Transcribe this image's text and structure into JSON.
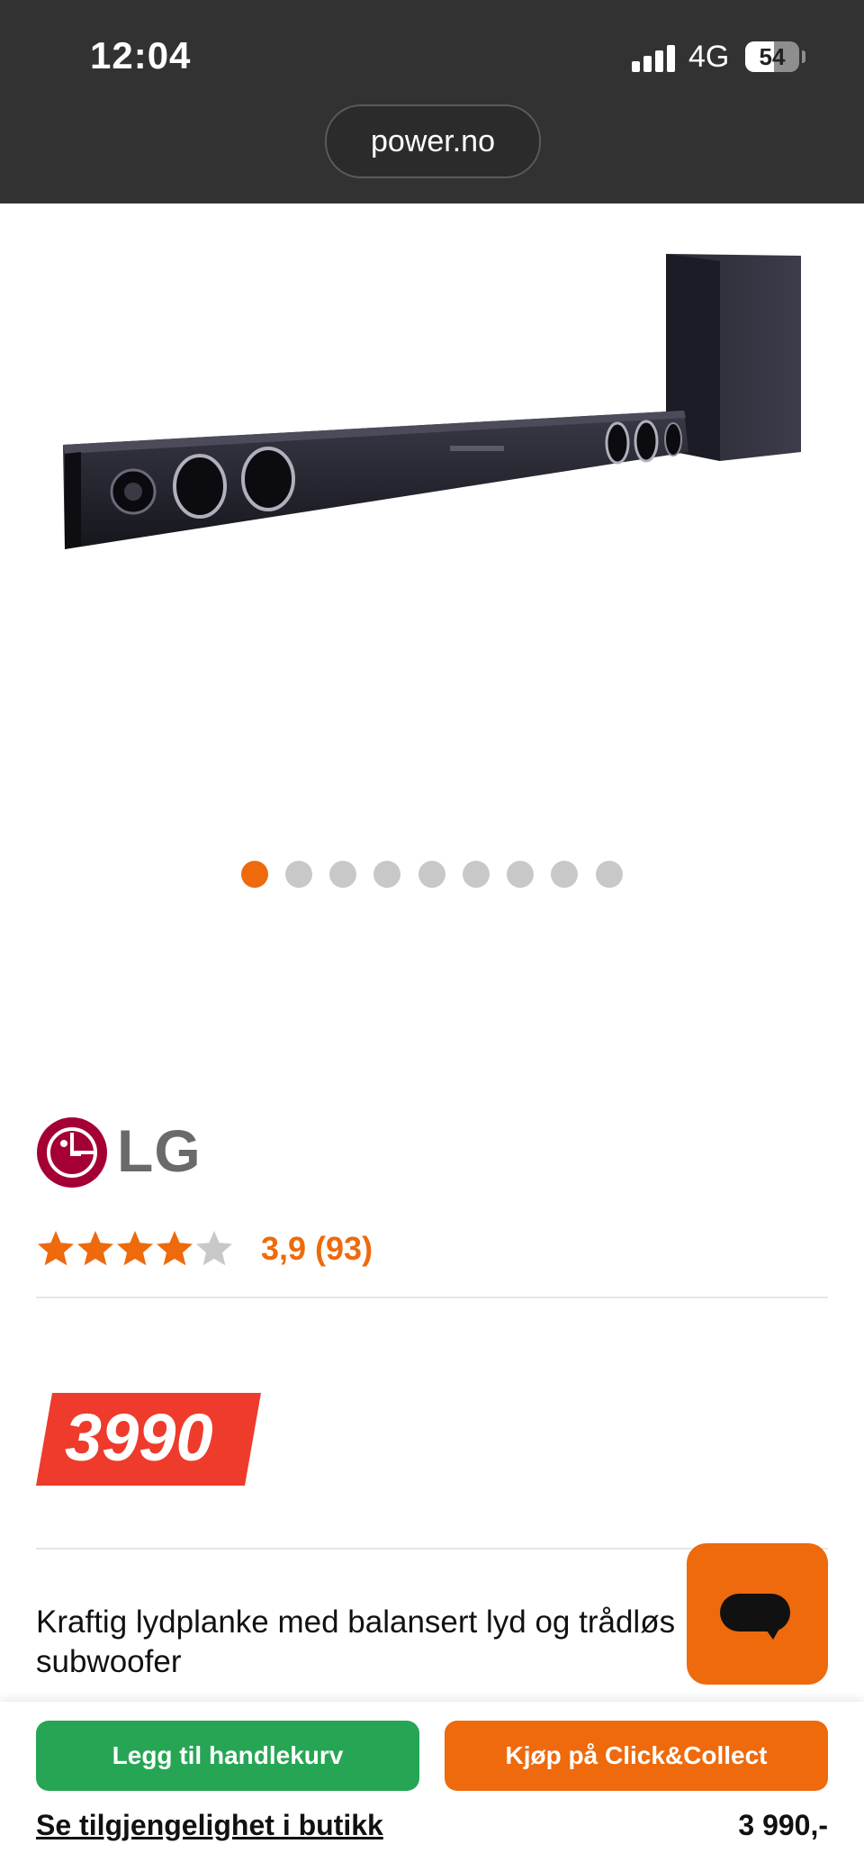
{
  "status": {
    "time": "12:04",
    "network": "4G",
    "battery": "54"
  },
  "browser": {
    "url": "power.no"
  },
  "carousel": {
    "total": 9,
    "active_index": 0
  },
  "brand": {
    "name": "LG"
  },
  "rating": {
    "stars_filled": 4,
    "stars_total": 5,
    "text": "3,9 (93)"
  },
  "price": {
    "badge": "3990"
  },
  "product": {
    "headline": "Kraftig lydplanke med balansert lyd og trådløs subwoofer"
  },
  "actions": {
    "add_to_cart": "Legg til handlekurv",
    "click_collect": "Kjøp på Click&Collect",
    "store_availability": "Se tilgjengelighet i butikk",
    "price": "3 990,-"
  },
  "colors": {
    "accent": "#ee6a0c",
    "green": "#26a654",
    "price_red": "#ee3b2b",
    "lg_red": "#a50034"
  },
  "icons": [
    "signal-icon",
    "battery-icon",
    "chat-icon",
    "star-icon",
    "lg-logo"
  ]
}
